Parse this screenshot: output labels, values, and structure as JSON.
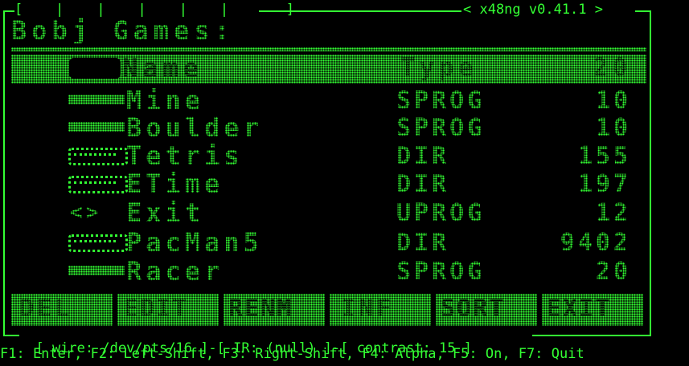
{
  "window": {
    "tab_slots": "[    |    |    |    |    |       ]",
    "title": "< x48ng v0.41.1 >"
  },
  "lcd": {
    "header": "Bobj Games:",
    "column_header": {
      "name": "Name",
      "type": "Type",
      "count": "20"
    },
    "rows": [
      {
        "icon": "dotted-bar-icon",
        "name": "Mine",
        "type": "SPROG",
        "count": "10"
      },
      {
        "icon": "dotted-bar-icon",
        "name": "Boulder",
        "type": "SPROG",
        "count": "10"
      },
      {
        "icon": "folder-icon",
        "name": "Tetris",
        "type": "DIR",
        "count": "155"
      },
      {
        "icon": "folder-icon",
        "name": "ETime",
        "type": "DIR",
        "count": "197"
      },
      {
        "icon": "exit-arrows-icon",
        "name": "Exit",
        "type": "UPROG",
        "count": "12"
      },
      {
        "icon": "folder-icon",
        "name": "PacMan5",
        "type": "DIR",
        "count": "9402"
      },
      {
        "icon": "dotted-bar-icon",
        "name": "Racer",
        "type": "SPROG",
        "count": "20"
      }
    ],
    "softkeys": [
      "DEL",
      "EDIT",
      "RENM",
      "INF",
      "SORT",
      "EXIT"
    ]
  },
  "status": {
    "wire": "[ wire: /dev/pts/16 ]",
    "ir": "[ IR: (null) ]",
    "contrast": "[ contrast: 15 ]",
    "separator": "-"
  },
  "keyhelp": "F1: Enter, F2: Left-Shift, F3: Right-Shift, F4: Alpha, F5: On, F7: Quit",
  "colors": {
    "foreground": "#33ff33",
    "background": "#000000"
  }
}
